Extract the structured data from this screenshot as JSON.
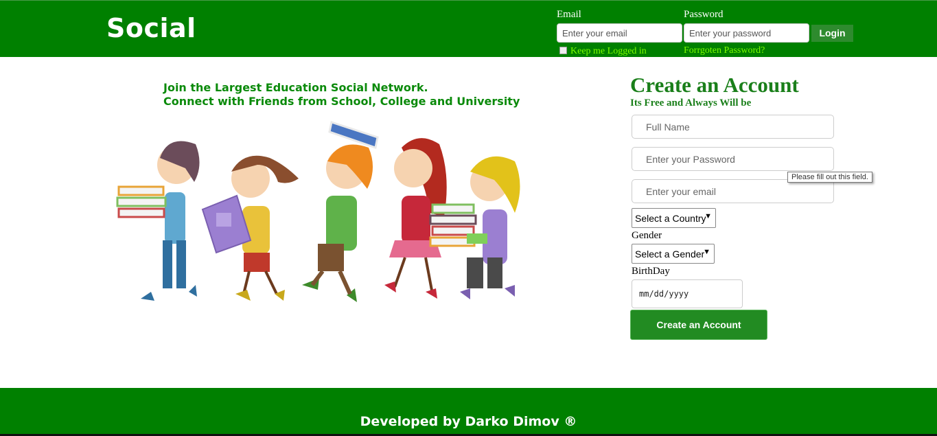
{
  "header": {
    "logo": "Social",
    "email_label": "Email",
    "password_label": "Password",
    "email_placeholder": "Enter your email",
    "password_placeholder": "Enter your password",
    "login_label": "Login",
    "keep_logged_label": "Keep me Logged in",
    "forgot_label": "Forrgoten Password?"
  },
  "main": {
    "tagline_line1": "Join the Largest Education Social Network.",
    "tagline_line2": "Connect with Friends from School, College and University"
  },
  "signup": {
    "title": "Create an Account",
    "subtitle": "Its Free and Always Will be",
    "fullname_placeholder": "Full Name",
    "password_placeholder": "Enter your Password",
    "email_placeholder": "Enter your email",
    "tooltip": "Please fill out this field.",
    "country_select": "Select a Country",
    "gender_label": "Gender",
    "gender_select": "Select a Gender",
    "birthday_label": "BirthDay",
    "birthday_value": "mm/dd/yyyy",
    "submit_label": "Create an Account"
  },
  "footer": {
    "text": "Developed by Darko Dimov ®"
  },
  "colors": {
    "brand_green": "#008000",
    "link_green": "#7cfc00",
    "title_green": "#1a7f1a"
  }
}
